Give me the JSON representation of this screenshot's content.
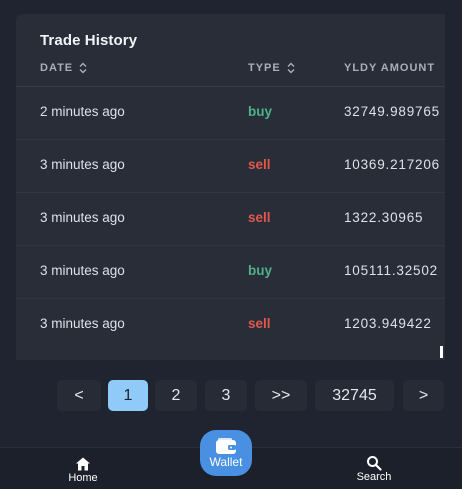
{
  "card": {
    "title": "Trade History",
    "columns": {
      "date": "DATE",
      "type": "TYPE",
      "amount": "YLDY AMOUNT"
    },
    "rows": [
      {
        "date": "2 minutes ago",
        "type": "buy",
        "amount": "32749.989765"
      },
      {
        "date": "3 minutes ago",
        "type": "sell",
        "amount": "10369.217206"
      },
      {
        "date": "3 minutes ago",
        "type": "sell",
        "amount": "1322.30965"
      },
      {
        "date": "3 minutes ago",
        "type": "buy",
        "amount": "105111.32502"
      },
      {
        "date": "3 minutes ago",
        "type": "sell",
        "amount": "1203.949422"
      }
    ]
  },
  "pagination": {
    "prev": "<",
    "pages": [
      "1",
      "2",
      "3"
    ],
    "jump": ">>",
    "last": "32745",
    "next": ">",
    "current": "1"
  },
  "nav": {
    "home": "Home",
    "wallet": "Wallet",
    "search": "Search"
  },
  "colors": {
    "buy": "#4fb089",
    "sell": "#e0594a",
    "active_page": "#90caf9",
    "wallet_button": "#4a90e2"
  }
}
